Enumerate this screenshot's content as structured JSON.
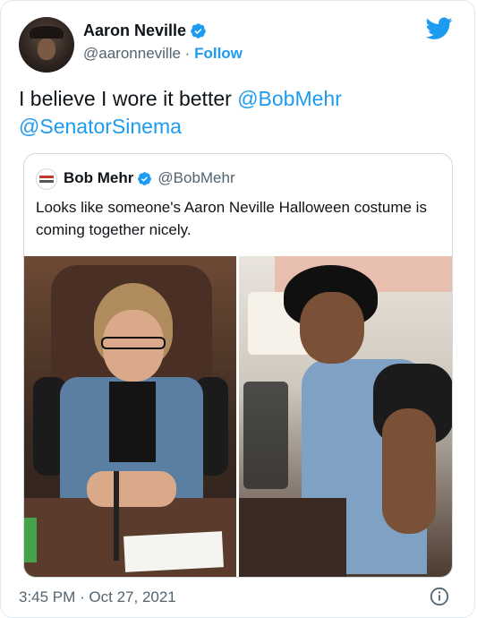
{
  "author": {
    "name": "Aaron Neville",
    "handle": "@aaronneville",
    "separator": "·",
    "follow_label": "Follow"
  },
  "tweet": {
    "text_prefix": "I believe I wore it better ",
    "mention_1": "@BobMehr",
    "mention_2": "@SenatorSinema"
  },
  "quoted": {
    "name": "Bob Mehr",
    "handle": "@BobMehr",
    "text": "Looks like someone's Aaron Neville Halloween costume is coming together nicely."
  },
  "footer": {
    "timestamp": "3:45 PM · Oct 27, 2021"
  },
  "icons": {
    "verified": "verified-badge-icon",
    "platform": "twitter-bird-icon",
    "info": "info-icon"
  },
  "colors": {
    "accent": "#1d9bf0",
    "secondary_text": "#536471",
    "border": "#cfd9de"
  }
}
